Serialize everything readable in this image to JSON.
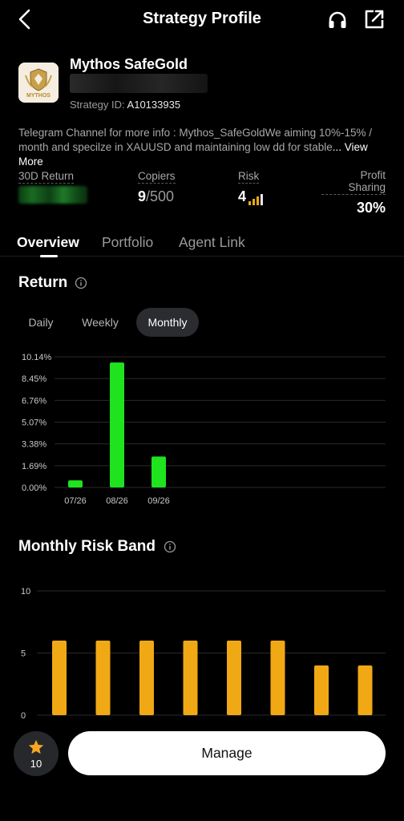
{
  "header": {
    "title": "Strategy Profile"
  },
  "strategy": {
    "name": "Mythos SafeGold",
    "id_label": "Strategy ID:",
    "id_value": "A10133935",
    "logo_text": "MYTHOS",
    "description": "Telegram Channel for more info : Mythos_SafeGoldWe aiming 10%-15% / month and specilze in XAUUSD and maintaining low dd for stable",
    "view_more": "... View More"
  },
  "stats": {
    "return_label": "30D Return",
    "copiers_label": "Copiers",
    "copiers_current": "9",
    "copiers_max": "/500",
    "risk_label": "Risk",
    "risk_value": "4",
    "risk_level": 4,
    "profit_label": "Profit Sharing",
    "profit_value": "30%"
  },
  "tabs": [
    {
      "label": "Overview",
      "active": true
    },
    {
      "label": "Portfolio",
      "active": false
    },
    {
      "label": "Agent Link",
      "active": false
    }
  ],
  "return_section": {
    "title": "Return",
    "periods": [
      {
        "label": "Daily",
        "active": false
      },
      {
        "label": "Weekly",
        "active": false
      },
      {
        "label": "Monthly",
        "active": true
      }
    ]
  },
  "risk_section": {
    "title": "Monthly Risk Band"
  },
  "colors": {
    "return_bar": "#1ee31e",
    "risk_bar": "#f0a814",
    "star": "#f5a623"
  },
  "chart_data": [
    {
      "type": "bar",
      "title": "Return",
      "categories": [
        "07/26",
        "08/26",
        "09/26"
      ],
      "values": [
        0.55,
        9.7,
        2.4
      ],
      "y_ticks": [
        "0.00%",
        "1.69%",
        "3.38%",
        "5.07%",
        "6.76%",
        "8.45%",
        "10.14%"
      ],
      "ylim": [
        0,
        10.14
      ],
      "grid": true
    },
    {
      "type": "bar",
      "title": "Monthly Risk Band",
      "categories": [
        "",
        "",
        "",
        "",
        "",
        "",
        "",
        ""
      ],
      "values": [
        6,
        6,
        6,
        6,
        6,
        6,
        4,
        4
      ],
      "y_ticks": [
        "0",
        "5",
        "10"
      ],
      "ylim": [
        0,
        10
      ],
      "grid": true
    }
  ],
  "footer": {
    "favorites_count": "10",
    "manage_label": "Manage"
  }
}
